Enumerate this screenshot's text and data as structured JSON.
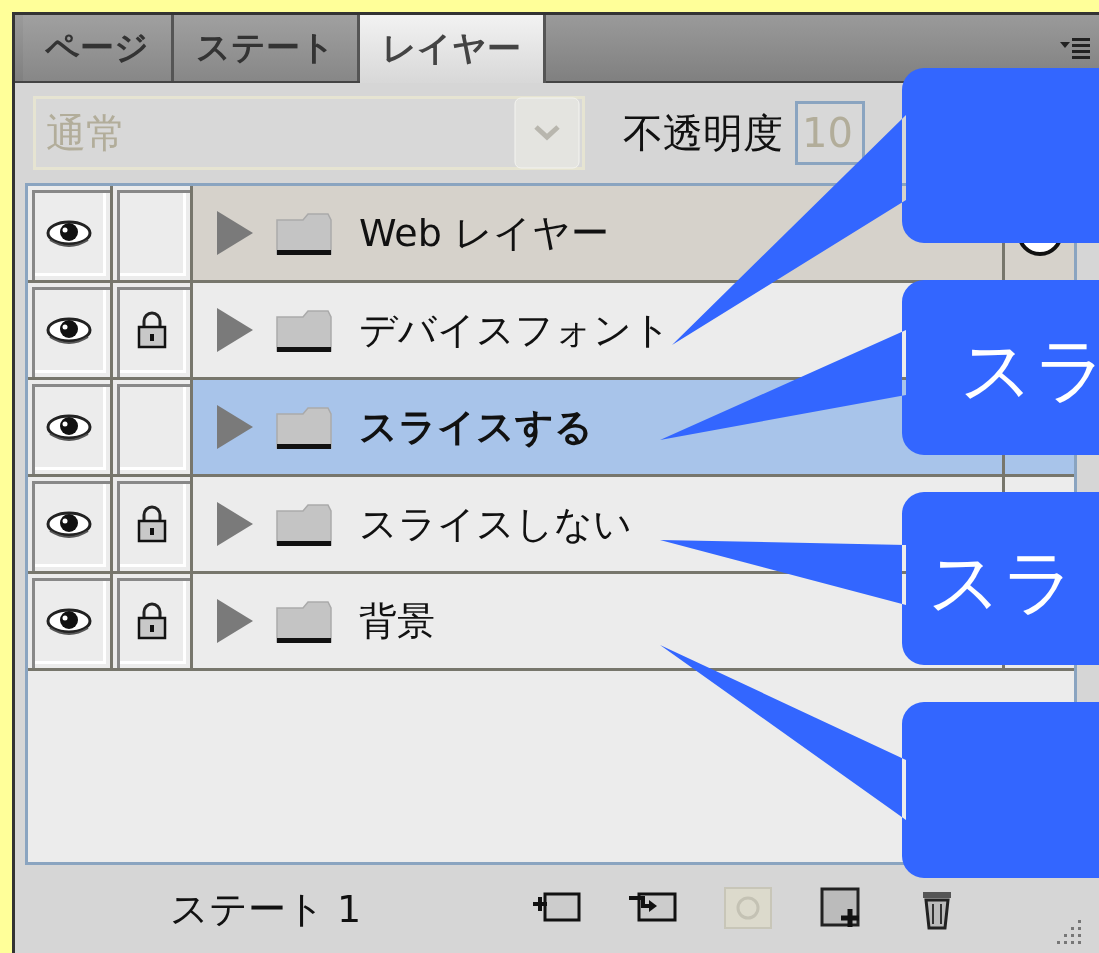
{
  "tabs": [
    {
      "label": "ページ",
      "selected": false
    },
    {
      "label": "ステート",
      "selected": false
    },
    {
      "label": "レイヤー",
      "selected": true
    }
  ],
  "blend_mode": {
    "value": "通常",
    "disabled": true
  },
  "opacity": {
    "label": "不透明度",
    "value": "10"
  },
  "layers": [
    {
      "name": "Web レイヤー",
      "kind": "web",
      "visible": true,
      "locked": false,
      "selected": false
    },
    {
      "name": "デバイスフォント",
      "kind": "folder",
      "visible": true,
      "locked": true,
      "selected": false
    },
    {
      "name": "スライスする",
      "kind": "folder",
      "visible": true,
      "locked": false,
      "selected": true
    },
    {
      "name": "スライスしない",
      "kind": "folder",
      "visible": true,
      "locked": true,
      "selected": false
    },
    {
      "name": "背景",
      "kind": "folder",
      "visible": true,
      "locked": true,
      "selected": false
    }
  ],
  "status_bar": {
    "state": "ステート 1"
  },
  "callouts": [
    {
      "kind": "blank"
    },
    {
      "kind": "labeled",
      "text": "スラ"
    },
    {
      "kind": "labeled",
      "text": "スラ"
    },
    {
      "kind": "blank"
    }
  ]
}
